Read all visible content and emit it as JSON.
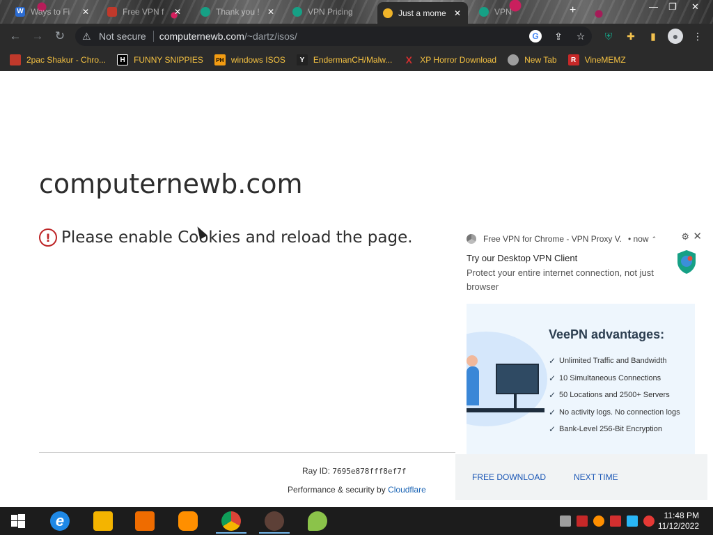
{
  "browser": {
    "tabs": [
      {
        "title": "Ways to Fi",
        "icon": "word-icon",
        "color": "#2b6cd3"
      },
      {
        "title": "Free VPN f",
        "icon": "tab-favicon-icon",
        "color": "#c0392b"
      },
      {
        "title": "Thank you !",
        "icon": "veepn-icon",
        "color": "#16a085"
      },
      {
        "title": "VPN Pricing",
        "icon": "veepn-icon",
        "color": "#16a085"
      },
      {
        "title": "Just a mome",
        "icon": "loading-icon",
        "color": "#f0b429",
        "active": true
      },
      {
        "title": "VPN",
        "icon": "veepn-icon",
        "color": "#16a085"
      }
    ],
    "address": {
      "security_label": "Not secure",
      "host": "computernewb.com",
      "path": "/~dartz/isos/"
    },
    "bookmarks": [
      {
        "label": "2pac Shakur - Chro...",
        "icon": "bookmark-favicon-icon",
        "color": "#c0392b",
        "glyph": ""
      },
      {
        "label": "FUNNY SNIPPIES",
        "icon": "h-icon",
        "color": "#000000",
        "glyph": "H"
      },
      {
        "label": "windows ISOS",
        "icon": "ph-icon",
        "color": "#f39c12",
        "glyph": "PH"
      },
      {
        "label": "EndermanCH/Malw...",
        "icon": "yp-icon",
        "color": "#222222",
        "glyph": "Y"
      },
      {
        "label": "XP Horror Download",
        "icon": "x-icon",
        "color": "#d32f2f",
        "glyph": "X"
      },
      {
        "label": "New Tab",
        "icon": "globe-icon",
        "color": "#9e9e9e",
        "glyph": ""
      },
      {
        "label": "VineMEMZ",
        "icon": "r-icon",
        "color": "#c62828",
        "glyph": "R"
      }
    ]
  },
  "page": {
    "site_title": "computernewb.com",
    "error_message": "Please enable Cookies and reload the page.",
    "ray_label": "Ray ID:",
    "ray_id": "7695e878fff8ef7f",
    "perf_prefix": "Performance & security by",
    "perf_link": "Cloudflare"
  },
  "notification": {
    "source": "Free VPN for Chrome - VPN Proxy V...",
    "time": "• now",
    "title": "Try our Desktop VPN Client",
    "body": "Protect your entire internet connection, not just browser",
    "image_title": "VeePN advantages:",
    "advantages": [
      "Unlimited Traffic and Bandwidth",
      "10 Simultaneous Connections",
      "50 Locations and 2500+ Servers",
      "No activity logs. No connection logs",
      "Bank-Level 256-Bit Encryption"
    ],
    "buttons": [
      "FREE DOWNLOAD",
      "NEXT TIME"
    ]
  },
  "taskbar": {
    "apps": [
      {
        "name": "internet-explorer-icon",
        "color": "#1e88e5"
      },
      {
        "name": "file-explorer-icon",
        "color": "#f4b400"
      },
      {
        "name": "media-player-icon",
        "color": "#ef6c00"
      },
      {
        "name": "uc-browser-icon",
        "color": "#ff8f00"
      },
      {
        "name": "chrome-icon",
        "color": "#db4437",
        "running": true
      },
      {
        "name": "app-icon",
        "color": "#5d4037"
      },
      {
        "name": "paint-icon",
        "color": "#8bc34a"
      }
    ],
    "time": "11:48 PM",
    "date": "11/12/2022"
  }
}
